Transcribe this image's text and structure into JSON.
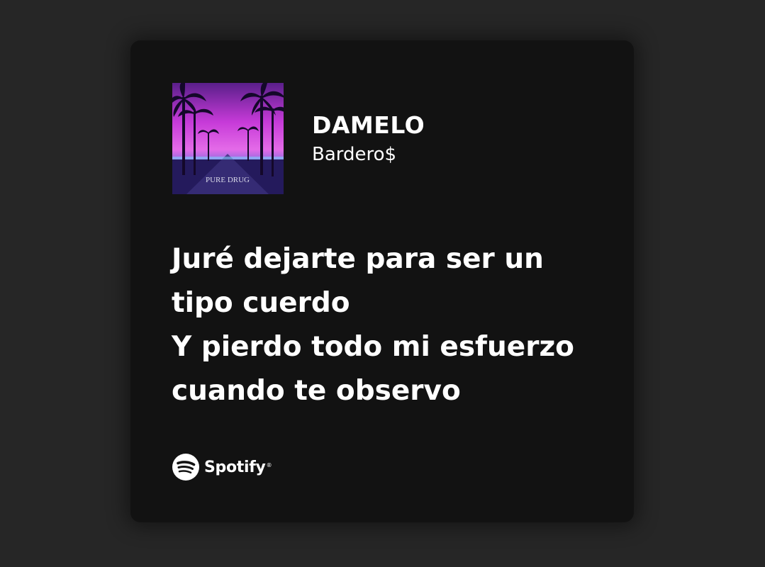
{
  "track": {
    "title": "DAMELO",
    "artist": "Bardero$",
    "cover_text": "PURE DRUG"
  },
  "lyrics": [
    "Juré dejarte para ser un",
    "tipo cuerdo",
    "Y pierdo todo mi esfuerzo",
    "cuando te observo"
  ],
  "brand": {
    "name": "Spotify",
    "icon": "spotify-icon"
  },
  "colors": {
    "page_background": "#262626",
    "card_background": "#121212",
    "text": "#ffffff"
  }
}
